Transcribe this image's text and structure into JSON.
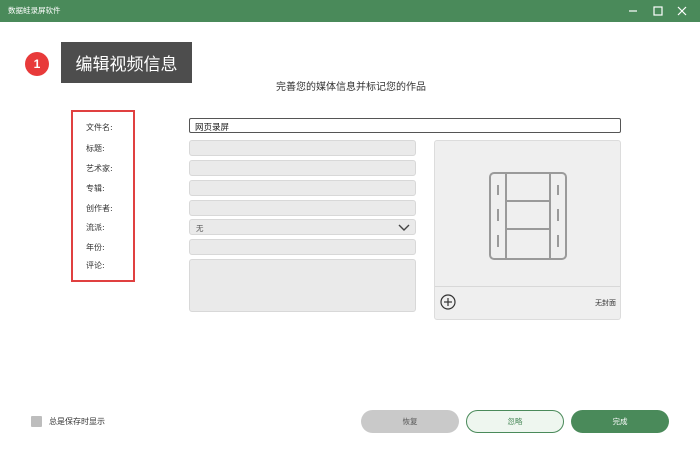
{
  "window": {
    "title": "数据蛙录屏软件"
  },
  "callout": {
    "step": "1",
    "text": "编辑视频信息"
  },
  "subtitle": "完善您的媒体信息并标记您的作品",
  "fields": {
    "filename": {
      "label": "文件名:",
      "value": "网页录屏"
    },
    "title": {
      "label": "标题:",
      "value": ""
    },
    "artist": {
      "label": "艺术家:",
      "value": ""
    },
    "album": {
      "label": "专辑:",
      "value": ""
    },
    "creator": {
      "label": "创作者:",
      "value": ""
    },
    "genre": {
      "label": "流派:",
      "value": "无"
    },
    "year": {
      "label": "年份:",
      "value": ""
    },
    "comment": {
      "label": "评论:",
      "value": ""
    }
  },
  "cover": {
    "label": "无封面"
  },
  "footer": {
    "always_show_label": "总是保存时显示",
    "restore_label": "恢复",
    "ignore_label": "忽略",
    "done_label": "完成"
  },
  "colors": {
    "brand": "#4a8a5a",
    "highlight": "#e04040",
    "badge": "#e83a3a"
  }
}
